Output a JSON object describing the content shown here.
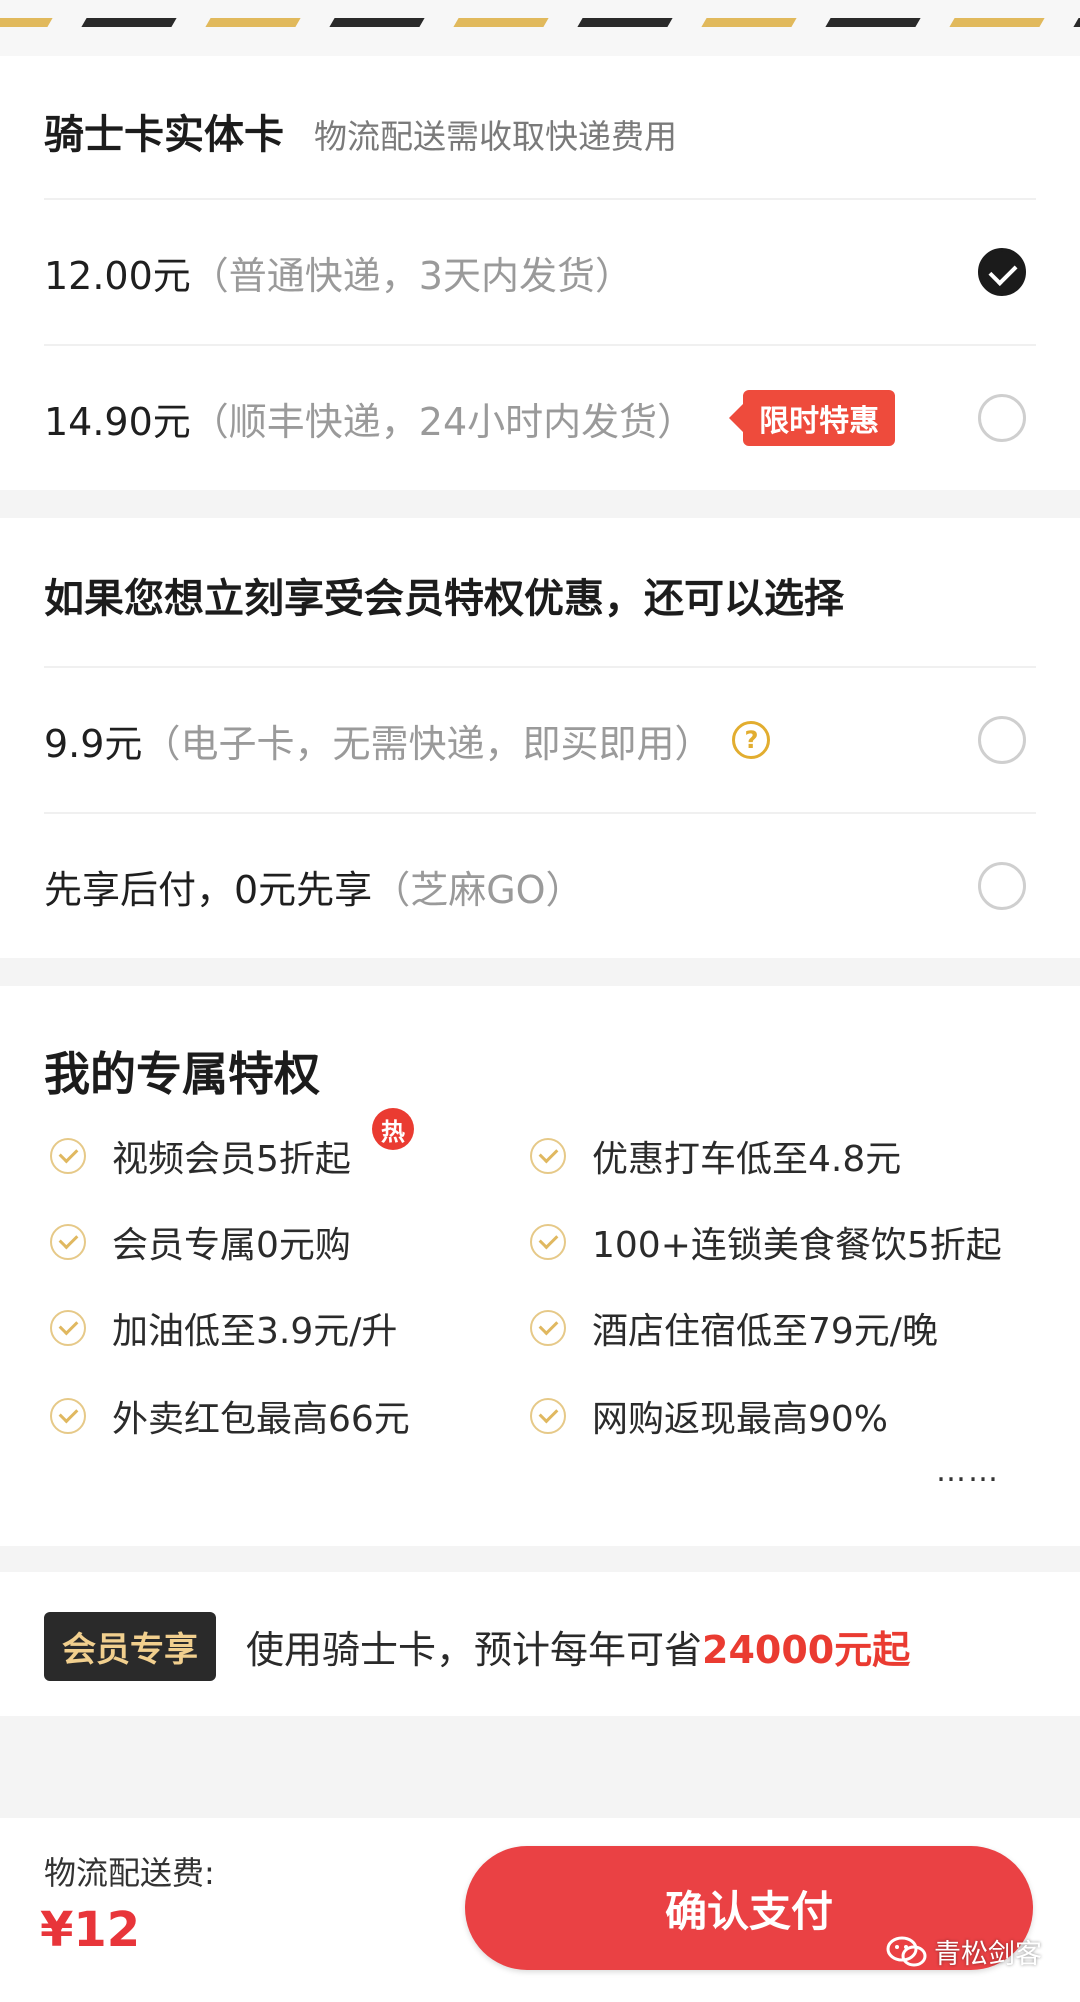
{
  "colors": {
    "accent_red": "#ea4144",
    "gold": "#e2ad2f",
    "stripe_gold": "#e1b95c",
    "stripe_dark": "#2a2a2a"
  },
  "delivery": {
    "title": "骑士卡实体卡",
    "subtitle": "物流配送需收取快递费用",
    "options": [
      {
        "price": "12.00元",
        "desc": "（普通快递，3天内发货）",
        "selected": true
      },
      {
        "price": "14.90元",
        "desc": "（顺丰快递，24小时内发货）",
        "tag": "限时特惠",
        "selected": false
      }
    ]
  },
  "alternative": {
    "title": "如果您想立刻享受会员特权优惠，还可以选择",
    "options": [
      {
        "price": "9.9元",
        "desc": "（电子卡，无需快递，即买即用）",
        "help_icon": "question-icon",
        "selected": false
      },
      {
        "price": "先享后付，0元先享",
        "desc": "（芝麻GO）",
        "selected": false
      }
    ]
  },
  "privileges": {
    "title": "我的专属特权",
    "hot_badge": "热",
    "items": [
      "视频会员5折起",
      "优惠打车低至4.8元",
      "会员专属0元购",
      "100+连锁美食餐饮5折起",
      "加油低至3.9元/升",
      "酒店住宿低至79元/晚",
      "外卖红包最高66元",
      "网购返现最高90%"
    ],
    "more": "……"
  },
  "member": {
    "badge": "会员专享",
    "text": "使用骑士卡，预计每年可省",
    "highlight": "24000元起"
  },
  "footer": {
    "fee_label": "物流配送费:",
    "fee_value": "¥12",
    "pay_button": "确认支付"
  },
  "watermark": {
    "text": "青松剑客",
    "icon": "wechat-icon"
  }
}
